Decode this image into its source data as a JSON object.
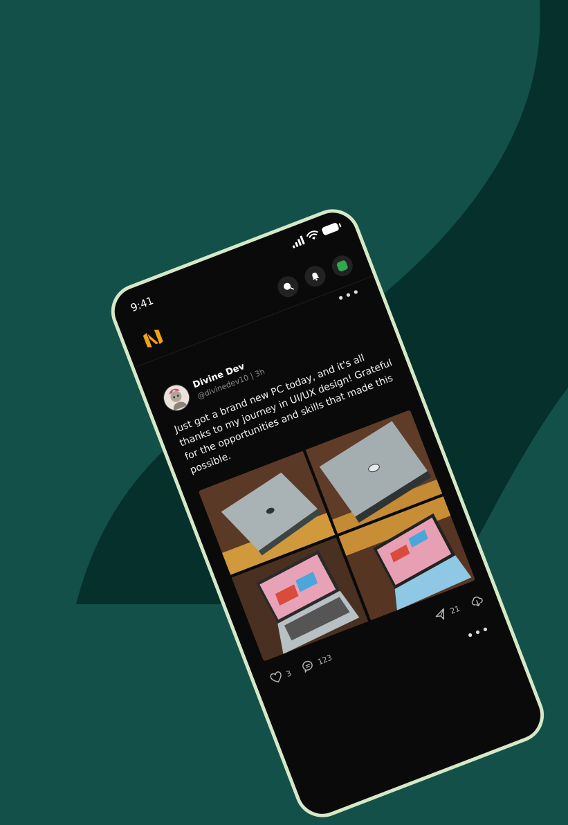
{
  "status_bar": {
    "time": "9:41"
  },
  "post": {
    "author": "Divine Dev",
    "handle": "@divinedev10",
    "separator": "|",
    "age": "3h",
    "text": "Just got a brand new PC today, and it's all thanks to my journey in UI/UX design! Grateful for the opportunities and skills that made this possible.",
    "likes": "3",
    "comments": "123",
    "shares": "21",
    "more_label": "•••"
  },
  "colors": {
    "background": "#13504A",
    "wave": "#06302C",
    "phone_frame": "#D6E8C6",
    "phone_screen": "#0A0A0A",
    "logo_accent": "#F2A11A",
    "status_dot": "#2FA84F"
  },
  "icons": {
    "logo": "brand-logo-icon",
    "search": "search-icon",
    "notifications": "bell-icon",
    "status": "status-dot-icon",
    "like": "heart-icon",
    "comment": "comment-icon",
    "share": "send-icon",
    "download": "cloud-download-icon"
  }
}
